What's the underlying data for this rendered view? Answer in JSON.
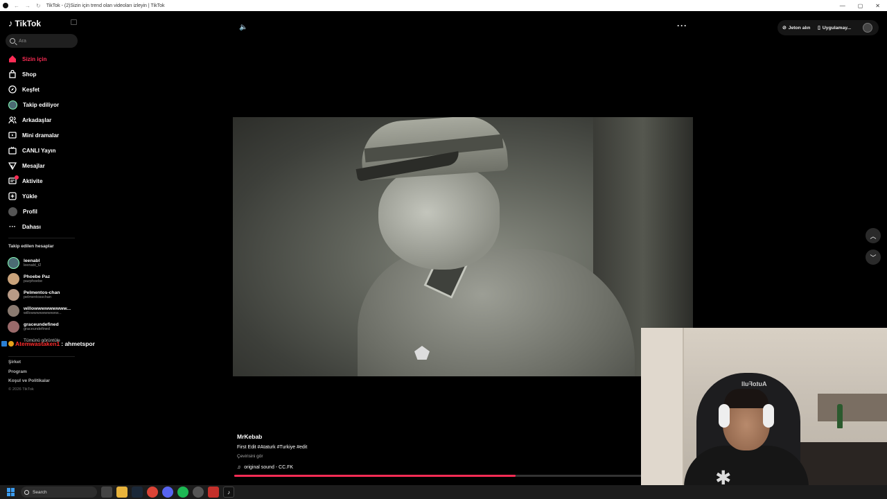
{
  "window": {
    "title": "TikTok - (2)Sizin için trend olan videoları izleyin | TikTok",
    "controls": [
      "—",
      "▢",
      "✕"
    ]
  },
  "sidebar": {
    "logo_text": "TikTok",
    "search_placeholder": "Ara",
    "nav": [
      {
        "label": "Sizin için",
        "icon": "home-icon",
        "active": true
      },
      {
        "label": "Shop",
        "icon": "shopping-bag-icon"
      },
      {
        "label": "Keşfet",
        "icon": "compass-icon"
      },
      {
        "label": "Takip ediliyor",
        "icon": "following-avatar-icon"
      },
      {
        "label": "Arkadaşlar",
        "icon": "friends-icon"
      },
      {
        "label": "Mini dramalar",
        "icon": "mini-drama-icon"
      },
      {
        "label": "CANLI Yayın",
        "icon": "live-icon"
      },
      {
        "label": "Mesajlar",
        "icon": "messages-icon"
      },
      {
        "label": "Aktivite",
        "icon": "activity-icon"
      },
      {
        "label": "Yükle",
        "icon": "upload-icon"
      },
      {
        "label": "Profil",
        "icon": "profile-avatar-icon"
      },
      {
        "label": "Dahası",
        "icon": "more-dots-icon"
      }
    ],
    "following_title": "Takip edilen hesaplar",
    "following": [
      {
        "name": "leenabl",
        "handle": "leenabl_t2",
        "color": "#4b6b73"
      },
      {
        "name": "Phoebe Paz",
        "handle": "pazphoebe",
        "color": "#c9a27a"
      },
      {
        "name": "Pelmentos-chan",
        "handle": "pelmentosschan",
        "color": "#b89a86"
      },
      {
        "name": "willowwwwwwwww...",
        "handle": "willowwwwwwwwww...",
        "color": "#8a7a70"
      },
      {
        "name": "graceundefined",
        "handle": "graceundefined",
        "color": "#9a6a6a"
      }
    ],
    "see_all": "Tümünü görüntüle",
    "footer": [
      "Şirket",
      "Program",
      "Koşul ve Politikalar"
    ],
    "copyright": "© 2026 TikTok"
  },
  "chat_overlay": {
    "user": "Atemwastaken1",
    "message": ": ahmetspor"
  },
  "topbar": {
    "coins_label": "Jeton alın",
    "app_label": "Uygulamay..."
  },
  "video": {
    "author": "MrKebab",
    "description": "First Edit #Ataturk #Turkiye #edit",
    "translate": "Çevirisini gör",
    "sound": "original sound - CC.FK",
    "progress": 0.69
  },
  "taskbar": {
    "search_label": "Search"
  },
  "colors": {
    "accent": "#fe2c55",
    "background": "#000000"
  }
}
